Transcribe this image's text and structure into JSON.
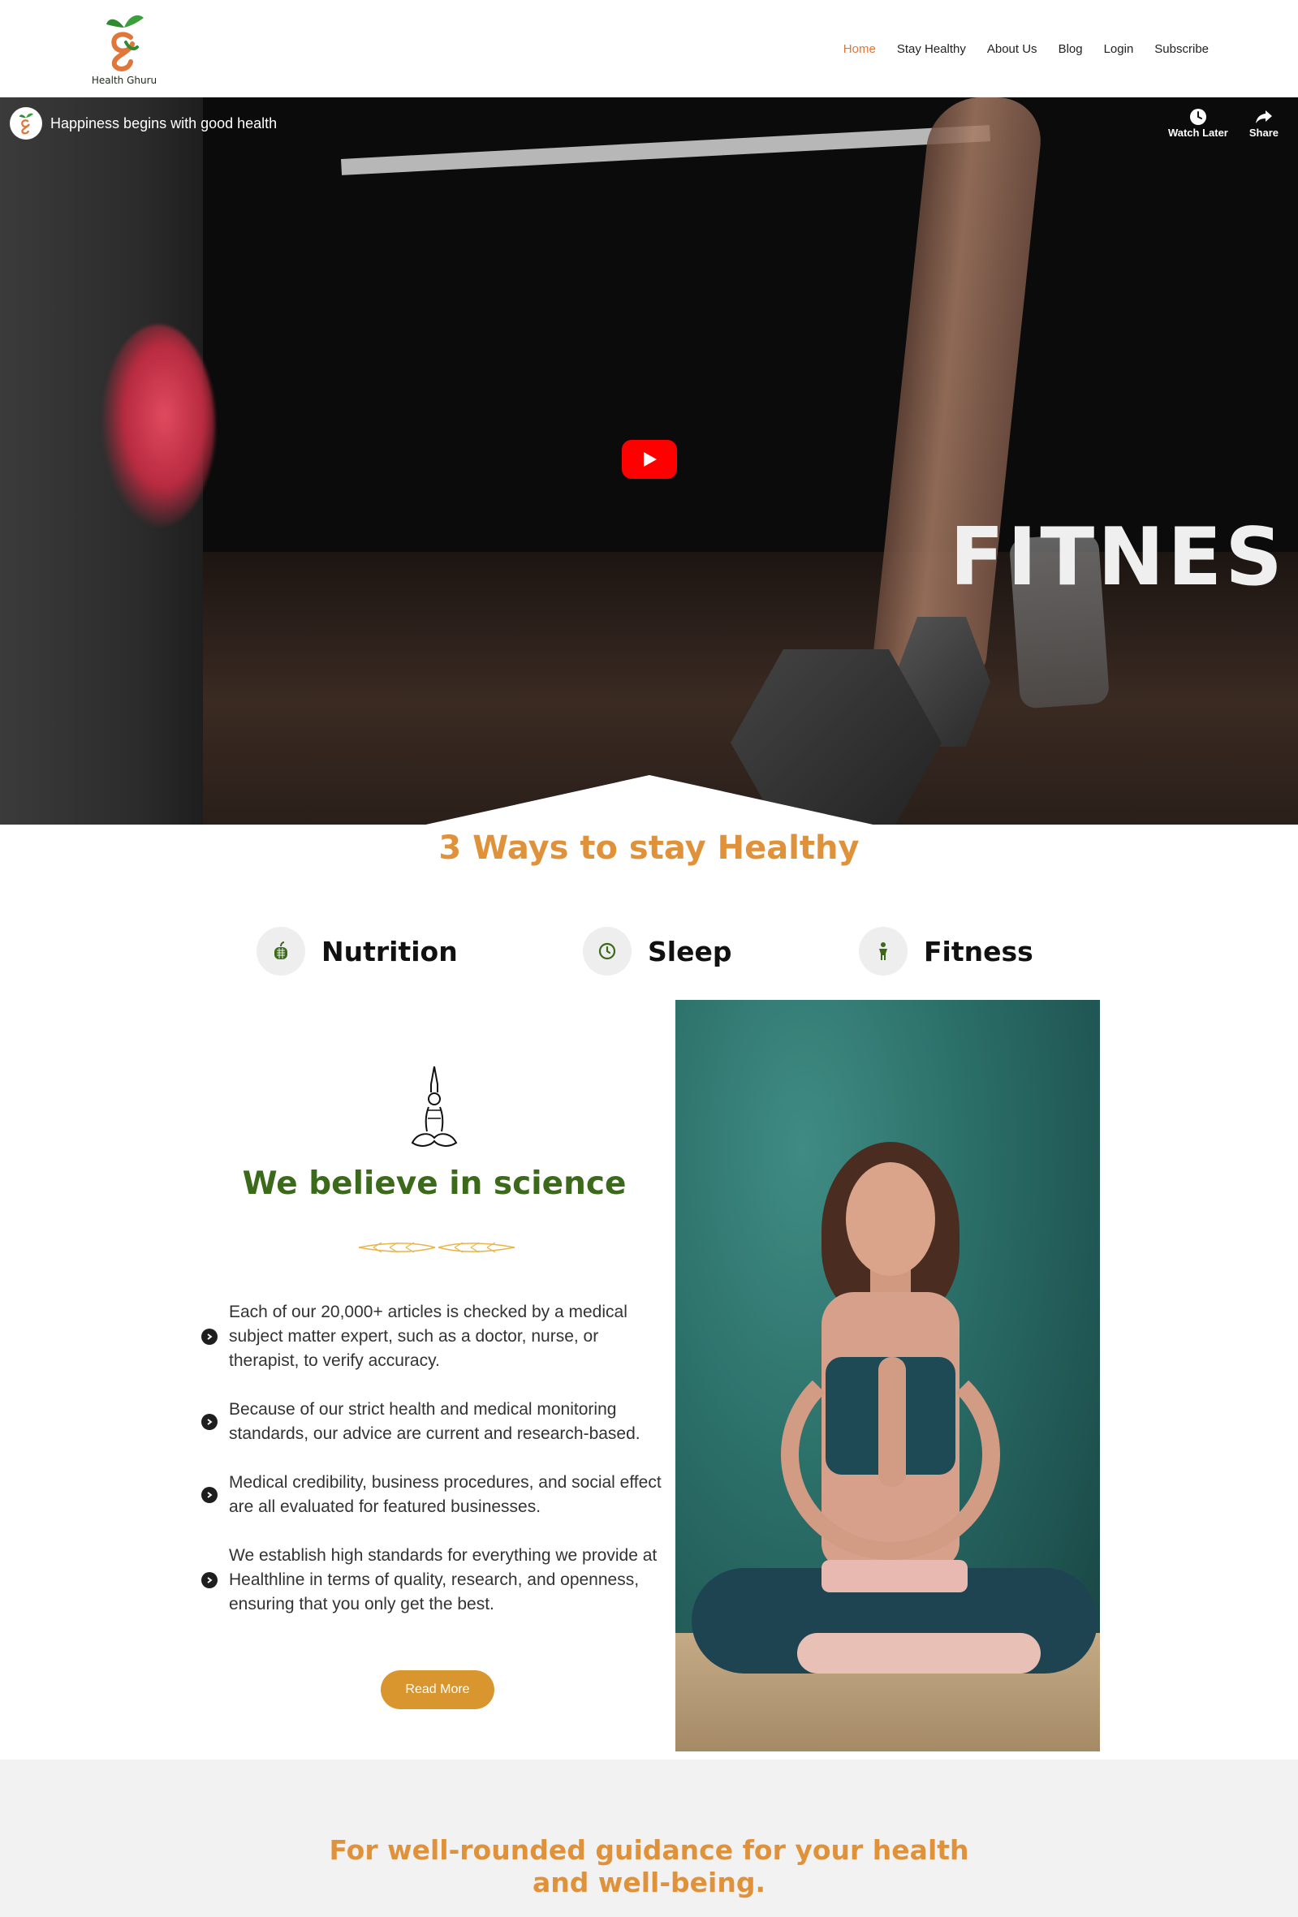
{
  "header": {
    "logo_text": "Health Ghuru",
    "nav": [
      "Home",
      "Stay Healthy",
      "About Us",
      "Blog",
      "Login",
      "Subscribe"
    ],
    "active_index": 0
  },
  "video": {
    "title": "Happiness begins with good health",
    "overlay_word": "FITNES",
    "actions": [
      "Watch Later",
      "Share"
    ],
    "play_icon": "play-icon"
  },
  "ways": {
    "title": "3 Ways to stay Healthy",
    "items": [
      {
        "label": "Nutrition",
        "icon": "apple-icon"
      },
      {
        "label": "Sleep",
        "icon": "clock-icon"
      },
      {
        "label": "Fitness",
        "icon": "person-icon"
      }
    ]
  },
  "science": {
    "title": "We believe in science",
    "bullets": [
      "Each of our 20,000+ articles is checked by a medical subject matter expert, such as a doctor, nurse, or therapist, to verify accuracy.",
      "Because of our strict health and medical monitoring standards, our advice are current and research-based.",
      "Medical credibility, business procedures, and social effect are all evaluated for featured businesses.",
      "We establish high standards for everything we provide at Healthline in terms of quality, research, and openness, ensuring that you only get the best."
    ],
    "read_more": "Read More"
  },
  "band": {
    "line1": "For well-rounded guidance for your health",
    "line2": "and well-being."
  },
  "colors": {
    "accent_orange": "#e0923a",
    "nav_active": "#e0763a",
    "science_green": "#3a6a1a",
    "button": "#d9962f",
    "youtube_red": "#ff0000"
  }
}
